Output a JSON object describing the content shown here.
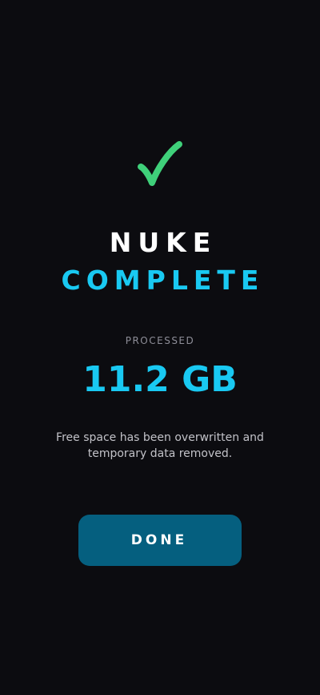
{
  "result": {
    "icon": "checkmark-icon",
    "title_line_1": "NUKE",
    "title_line_2": "COMPLETE",
    "processed_label": "PROCESSED",
    "processed_value": "11.2 GB",
    "description": "Free space has been overwritten and temporary data removed."
  },
  "actions": {
    "done_label": "DONE"
  },
  "colors": {
    "background": "#0c0c10",
    "accent": "#19c9f2",
    "success": "#3fd07a",
    "button": "#055f7f"
  }
}
